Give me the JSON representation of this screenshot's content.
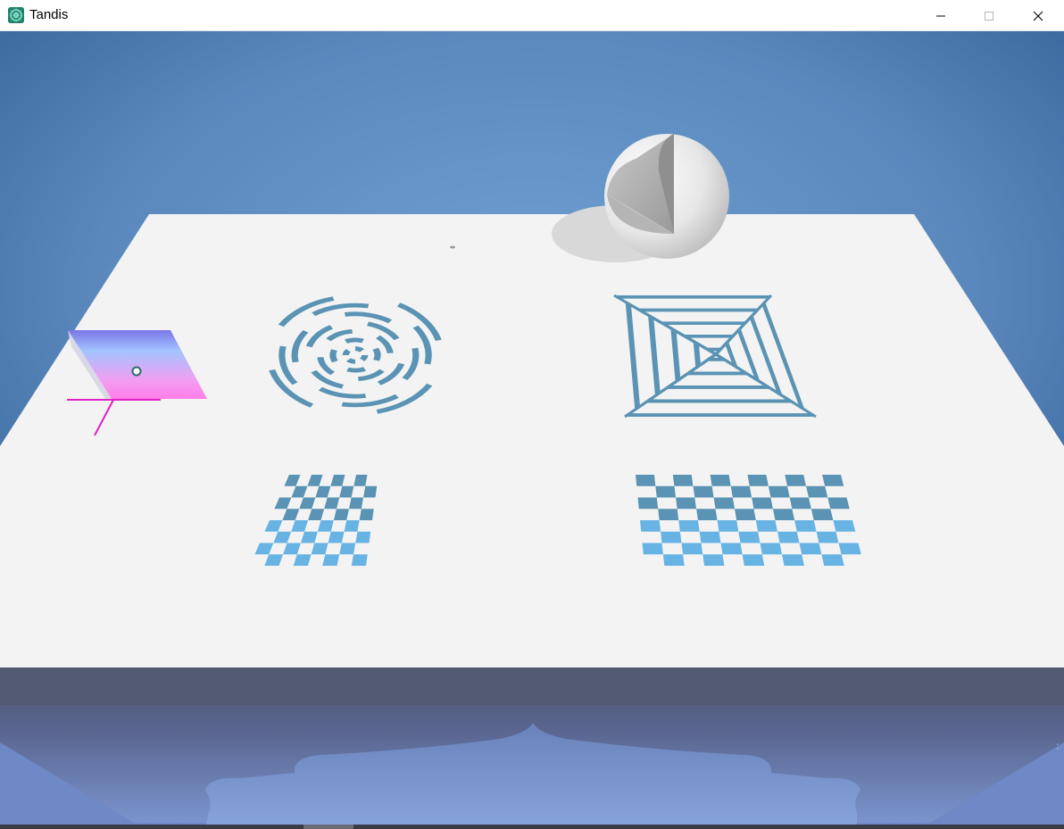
{
  "window": {
    "title": "Tandis",
    "app_icon": "tandis-app-icon",
    "controls": [
      {
        "name": "minimize-button",
        "icon": "minimize-icon"
      },
      {
        "name": "maximize-button",
        "icon": "maximize-icon",
        "disabled": true
      },
      {
        "name": "close-button",
        "icon": "close-icon"
      }
    ]
  },
  "scene": {
    "background_colors": [
      "#2f5b8f",
      "#5f8ec5",
      "#6d8fc7"
    ],
    "table_color": "#f3f3f3",
    "pattern_color": "#5a93b3",
    "pattern_color_light": "#67b3e4",
    "objects": [
      "cut-sphere",
      "gradient-parallelogram",
      "concentric-ring-target",
      "spiral-square-target",
      "small-checkerboard",
      "large-checkerboard"
    ]
  }
}
